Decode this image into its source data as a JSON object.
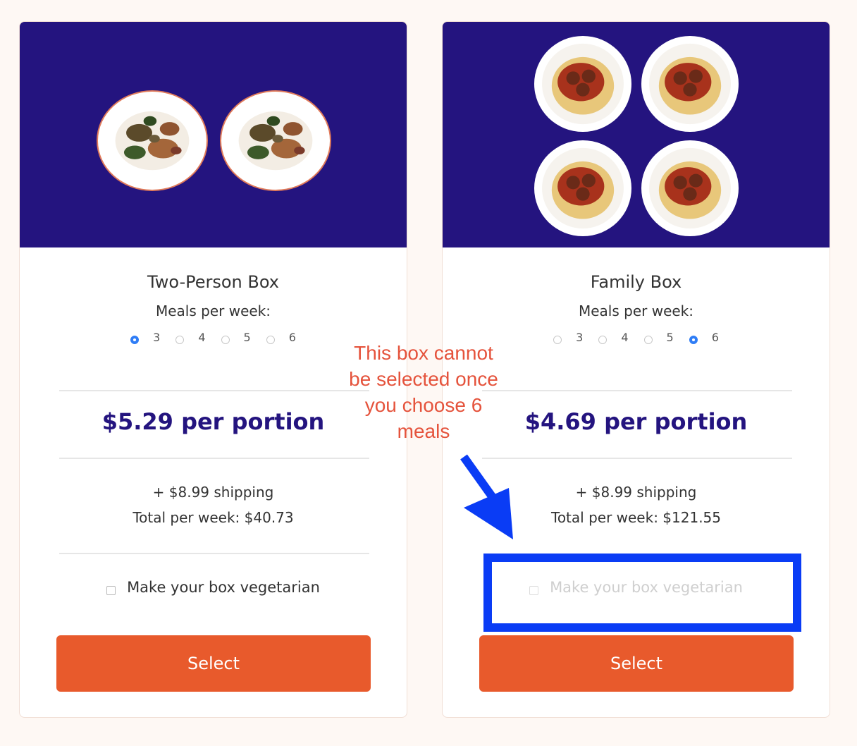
{
  "colors": {
    "page_bg": "#fef8f4",
    "hero_bg": "#24147f",
    "price": "#24147f",
    "button": "#e85a2c",
    "radio_selected": "#2f7df6",
    "annotation_text": "#e5533c",
    "annotation_box": "#0a3cf5"
  },
  "cards": [
    {
      "id": "two-person",
      "image": "roasted-chicken-plates",
      "title": "Two-Person Box",
      "meals_label": "Meals per week:",
      "meal_options": [
        "3",
        "4",
        "5",
        "6"
      ],
      "selected_meals": "3",
      "price": "$5.29 per portion",
      "shipping": "+ $8.99 shipping",
      "total": "Total per week: $40.73",
      "vegetarian_label": "Make your box vegetarian",
      "vegetarian_checked": false,
      "vegetarian_disabled": false,
      "select_label": "Select"
    },
    {
      "id": "family",
      "image": "spaghetti-meatball-plates",
      "title": "Family Box",
      "meals_label": "Meals per week:",
      "meal_options": [
        "3",
        "4",
        "5",
        "6"
      ],
      "selected_meals": "6",
      "price": "$4.69 per portion",
      "shipping": "+ $8.99 shipping",
      "total": "Total per week: $121.55",
      "vegetarian_label": "Make your box vegetarian",
      "vegetarian_checked": false,
      "vegetarian_disabled": true,
      "select_label": "Select"
    }
  ],
  "annotation": {
    "lines": [
      "This box cannot",
      "be selected once",
      "you choose 6",
      "meals"
    ]
  }
}
